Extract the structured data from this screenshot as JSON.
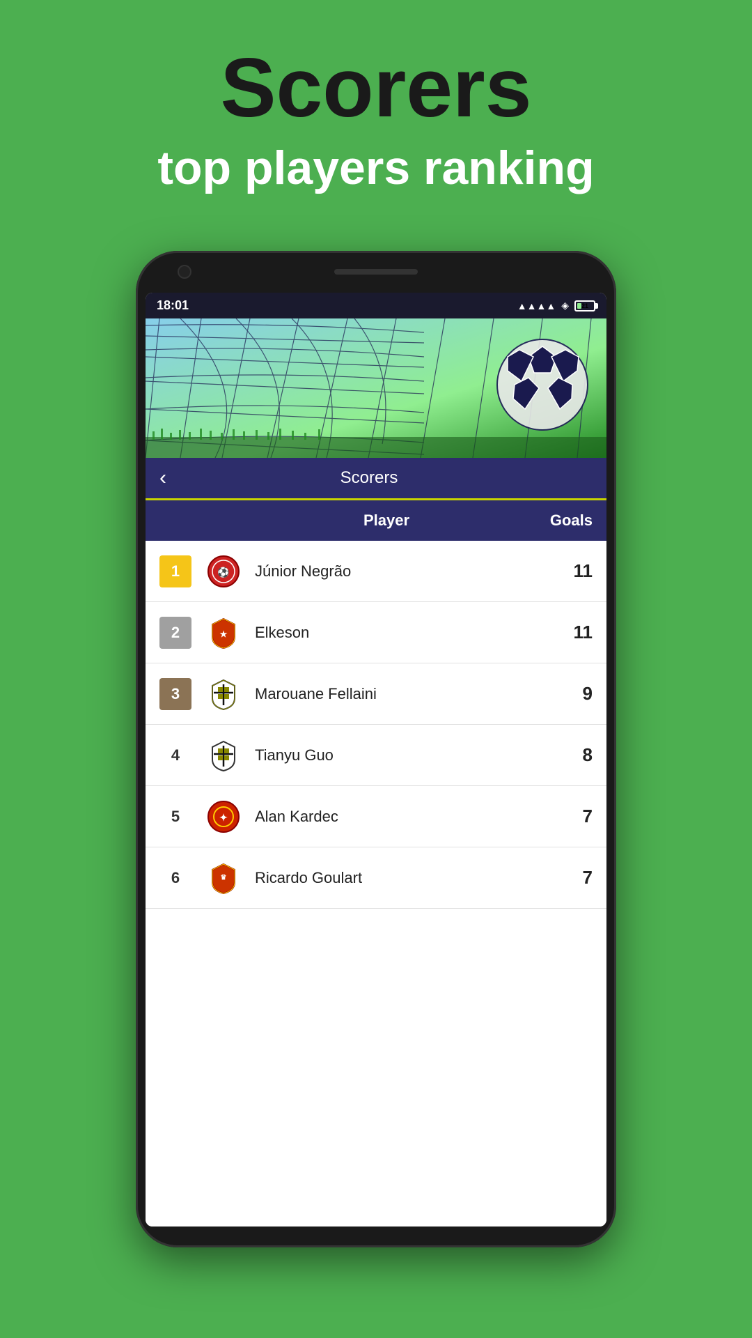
{
  "page": {
    "background_color": "#4caf50",
    "main_title": "Scorers",
    "sub_title": "top players ranking"
  },
  "status_bar": {
    "time": "18:01",
    "battery_level": "21"
  },
  "toolbar": {
    "title": "Scorers",
    "back_label": "‹"
  },
  "table_header": {
    "player_col": "Player",
    "goals_col": "Goals"
  },
  "scorers": [
    {
      "rank": 1,
      "rank_type": "gold",
      "name": "Júnior Negrão",
      "goals": 11,
      "team_color": "#cc2222"
    },
    {
      "rank": 2,
      "rank_type": "silver",
      "name": "Elkeson",
      "goals": 11,
      "team_color": "#cc3300"
    },
    {
      "rank": 3,
      "rank_type": "bronze",
      "name": "Marouane Fellaini",
      "goals": 9,
      "team_color": "#888800"
    },
    {
      "rank": 4,
      "rank_type": "plain",
      "name": "Tianyu Guo",
      "goals": 8,
      "team_color": "#888800"
    },
    {
      "rank": 5,
      "rank_type": "plain",
      "name": "Alan Kardec",
      "goals": 7,
      "team_color": "#cc2200"
    },
    {
      "rank": 6,
      "rank_type": "plain",
      "name": "Ricardo Goulart",
      "goals": 7,
      "team_color": "#cc3300"
    }
  ]
}
